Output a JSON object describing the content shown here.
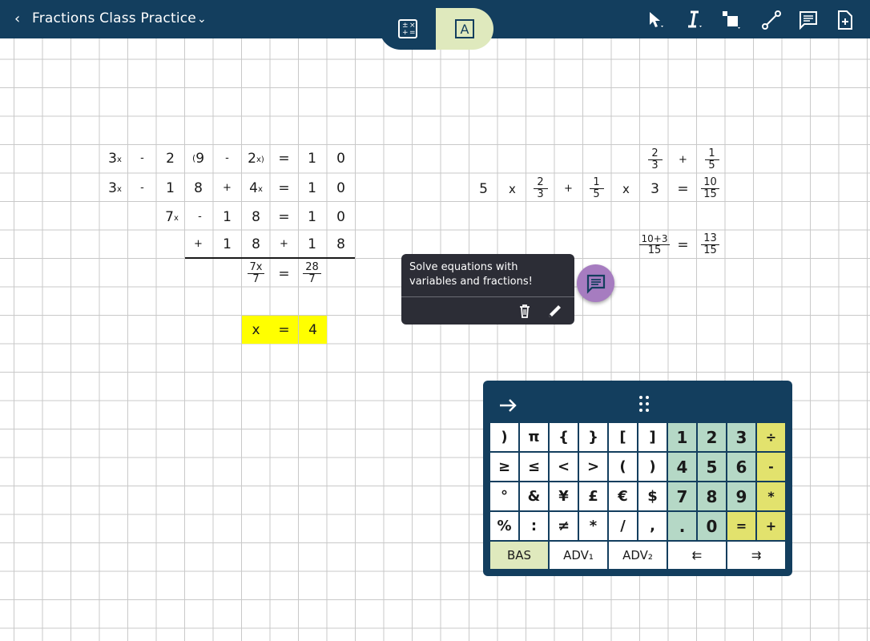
{
  "header": {
    "title": "Fractions Class Practice",
    "back_glyph": "‹",
    "menu_glyph": "⌄",
    "tools": [
      "cursor-select-icon",
      "text-cursor-icon",
      "shape-icon",
      "line-tool-icon",
      "comment-icon",
      "add-page-icon"
    ],
    "mode_tabs": [
      "calculator-icon",
      "text-mode-icon"
    ]
  },
  "equation_left": {
    "row1": [
      "3",
      "x",
      "-",
      "2",
      "(",
      "9",
      "-",
      "2",
      "x)",
      "=",
      "1",
      "0"
    ],
    "row2": [
      "3",
      "x",
      "-",
      "1",
      "8",
      "+",
      "4",
      "x",
      "=",
      "1",
      "0"
    ],
    "row3": [
      "7",
      "x",
      "-",
      "1",
      "8",
      "=",
      "1",
      "0"
    ],
    "row4": [
      "+",
      "1",
      "8",
      "+",
      "1",
      "8"
    ],
    "row5": {
      "frac1_num": "7x",
      "frac1_den": "7",
      "eq": "=",
      "frac2_num": "28",
      "frac2_den": "7"
    },
    "answer": [
      "x",
      "=",
      "4"
    ]
  },
  "equation_right": {
    "top": {
      "frac1_num": "2",
      "frac1_den": "3",
      "plus": "+",
      "frac2_num": "1",
      "frac2_den": "5"
    },
    "main": {
      "five": "5",
      "times1": "x",
      "frac1_num": "2",
      "frac1_den": "3",
      "plus": "+",
      "frac2_num": "1",
      "frac2_den": "5",
      "times2": "x",
      "three": "3",
      "eq": "=",
      "result_num": "10",
      "result_den": "15"
    },
    "bottom": {
      "frac1_num": "10+3",
      "frac1_den": "15",
      "eq": "=",
      "frac2_num": "13",
      "frac2_den": "15"
    }
  },
  "tooltip": {
    "text": "Solve equations with variables and fractions!",
    "delete_icon": "trash-icon",
    "edit_icon": "pencil-icon"
  },
  "keypad": {
    "rows": [
      [
        ")",
        "π",
        "{",
        "}",
        "[",
        "]",
        "1",
        "2",
        "3",
        "÷"
      ],
      [
        "≥",
        "≤",
        "<",
        ">",
        "(",
        ")",
        "4",
        "5",
        "6",
        "-"
      ],
      [
        "°",
        "&",
        "¥",
        "£",
        "€",
        "$",
        "7",
        "8",
        "9",
        "*"
      ],
      [
        "%",
        ":",
        "≠",
        "*",
        "/",
        ",",
        ".",
        "0",
        "=",
        "+"
      ]
    ],
    "bottom": [
      "BAS",
      "ADV₁",
      "ADV₂",
      "⇇",
      "⇉"
    ],
    "colors": {
      "number_key": "#b5d8c6",
      "operator_key": "#e2e26d",
      "bas_key": "#dfe9bd",
      "frame": "#133e5e"
    }
  },
  "colors": {
    "topbar": "#133e5e",
    "highlight": "#ffff00",
    "tooltip": "#2c2d36",
    "fab": "#a67cc0"
  }
}
